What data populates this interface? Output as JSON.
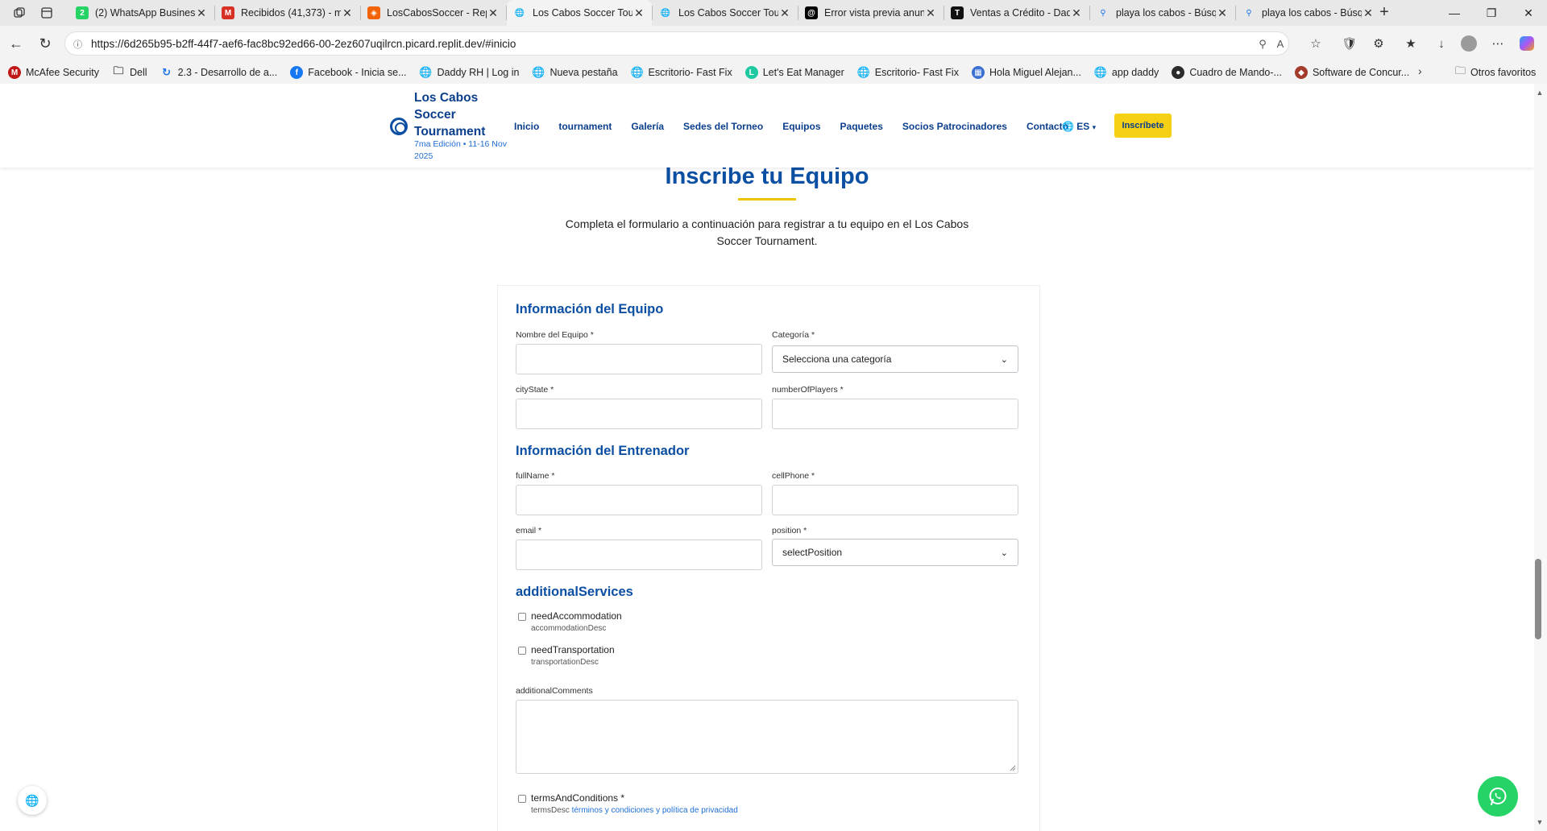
{
  "browser": {
    "tabs": [
      {
        "title": "(2) WhatsApp Business",
        "icon": "whatsapp-icon",
        "color": "#25d366"
      },
      {
        "title": "Recibidos (41,373) - m",
        "icon": "gmail-icon",
        "color": "#d93025"
      },
      {
        "title": "LosCabosSoccer - Repl",
        "icon": "replit-icon",
        "color": "#f26207"
      },
      {
        "title": "Los Cabos Soccer Tour",
        "icon": "globe-icon",
        "color": "#555555",
        "active": true
      },
      {
        "title": "Los Cabos Soccer Tour",
        "icon": "globe-icon",
        "color": "#555555"
      },
      {
        "title": "Error vista previa anun",
        "icon": "threads-icon",
        "color": "#000000"
      },
      {
        "title": "Ventas a Crédito - Dad",
        "icon": "t-icon",
        "color": "#111111"
      },
      {
        "title": "playa los cabos - Búsq",
        "icon": "search-icon",
        "color": "#1a73e8"
      },
      {
        "title": "playa los cabos - Búsq",
        "icon": "search-icon",
        "color": "#1a73e8"
      }
    ],
    "url": "https://6d265b95-b2ff-44f7-aef6-fac8bc92ed66-00-2ez607uqilrcn.picard.replit.dev/#inicio",
    "bookmarks": [
      {
        "label": "McAfee Security",
        "icon": "mcafee-icon",
        "color": "#c01818"
      },
      {
        "label": "Dell",
        "icon": "folder-icon",
        "color": "#444444"
      },
      {
        "label": "2.3 - Desarrollo de a...",
        "icon": "loading-icon",
        "color": "#1a73e8"
      },
      {
        "label": "Facebook - Inicia se...",
        "icon": "facebook-icon",
        "color": "#1877f2"
      },
      {
        "label": "Daddy RH | Log in",
        "icon": "globe-icon",
        "color": "#555555"
      },
      {
        "label": "Nueva pestaña",
        "icon": "globe-icon",
        "color": "#555555"
      },
      {
        "label": "Escritorio- Fast Fix",
        "icon": "globe-icon",
        "color": "#555555"
      },
      {
        "label": "Let's Eat Manager",
        "icon": "lets-eat-icon",
        "color": "#1ec8a0"
      },
      {
        "label": "Escritorio- Fast Fix",
        "icon": "globe-icon",
        "color": "#555555"
      },
      {
        "label": "Hola Miguel Alejan...",
        "icon": "app-icon",
        "color": "#3b6fd1"
      },
      {
        "label": "app daddy",
        "icon": "globe-icon",
        "color": "#555555"
      },
      {
        "label": "Cuadro de Mando-...",
        "icon": "dashboard-icon",
        "color": "#2b2b2b"
      },
      {
        "label": "Software de Concur...",
        "icon": "software-icon",
        "color": "#a33a2a"
      }
    ],
    "other_favorites": "Otros favoritos"
  },
  "site": {
    "brand": "Los Cabos Soccer Tournament",
    "edition": "7ma Edición • 11-16 Nov 2025",
    "nav": [
      "Inicio",
      "tournament",
      "Galería",
      "Sedes del Torneo",
      "Equipos",
      "Paquetes",
      "Socios Patrocinadores",
      "Contacto"
    ],
    "language": "ES",
    "cta": "Inscríbete"
  },
  "registration": {
    "title": "Inscribe tu Equipo",
    "description": "Completa el formulario a continuación para registrar a tu equipo en el Los Cabos Soccer Tournament.",
    "team_section": "Información del Equipo",
    "team_name_label": "Nombre del Equipo *",
    "category_label": "Categoría *",
    "category_value": "Selecciona una categoría",
    "city_label": "cityState *",
    "players_label": "numberOfPlayers *",
    "coach_section": "Información del Entrenador",
    "fullname_label": "fullName *",
    "cellphone_label": "cellPhone *",
    "email_label": "email *",
    "position_label": "position *",
    "position_value": "selectPosition",
    "services_section": "additionalServices",
    "accommodation_label": "needAccommodation",
    "accommodation_desc": "accommodationDesc",
    "transportation_label": "needTransportation",
    "transportation_desc": "transportationDesc",
    "comments_label": "additionalComments",
    "terms_label": "termsAndConditions *",
    "terms_desc_prefix": "termsDesc",
    "terms_link": "términos y condiciones y política de privacidad"
  },
  "colors": {
    "primary": "#0b4fa3",
    "accent": "#f5d014",
    "whatsapp": "#25d366"
  }
}
